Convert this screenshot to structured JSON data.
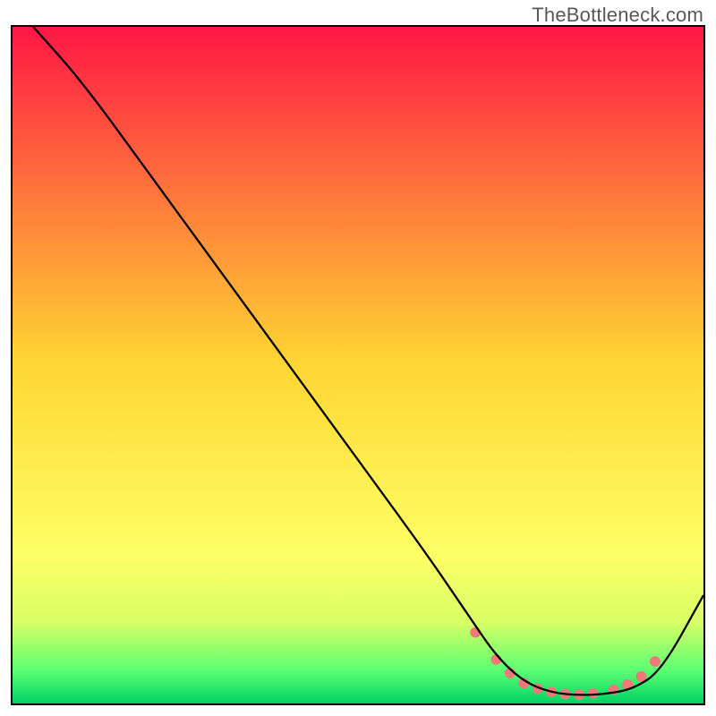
{
  "watermark": "TheBottleneck.com",
  "chart_data": {
    "type": "line",
    "title": "",
    "xlabel": "",
    "ylabel": "",
    "xlim": [
      0,
      100
    ],
    "ylim": [
      0,
      100
    ],
    "grid": false,
    "background_gradient": {
      "stops": [
        {
          "offset": 0.0,
          "color": "#ff1744"
        },
        {
          "offset": 0.5,
          "color": "#ffd733"
        },
        {
          "offset": 0.78,
          "color": "#feff66"
        },
        {
          "offset": 0.88,
          "color": "#d8ff66"
        },
        {
          "offset": 0.95,
          "color": "#5eff73"
        },
        {
          "offset": 1.0,
          "color": "#00d366"
        }
      ]
    },
    "series": [
      {
        "name": "curve",
        "color": "#000000",
        "width": 2.3,
        "x": [
          3,
          10,
          20,
          30,
          40,
          50,
          60,
          66,
          70,
          74,
          78,
          82,
          86,
          90,
          94,
          100
        ],
        "y": [
          100,
          92,
          78,
          64,
          50,
          36,
          22,
          13,
          7,
          3.2,
          1.6,
          1.2,
          1.4,
          2.2,
          5,
          16
        ]
      }
    ],
    "markers": {
      "color": "#f07878",
      "radius": 6,
      "x": [
        67,
        70,
        72,
        74,
        76,
        78,
        80,
        82,
        84,
        87,
        89,
        91,
        93
      ],
      "y": [
        10.5,
        6.5,
        4.5,
        3.0,
        2.2,
        1.7,
        1.4,
        1.3,
        1.5,
        2.0,
        2.8,
        4.0,
        6.2
      ]
    }
  }
}
